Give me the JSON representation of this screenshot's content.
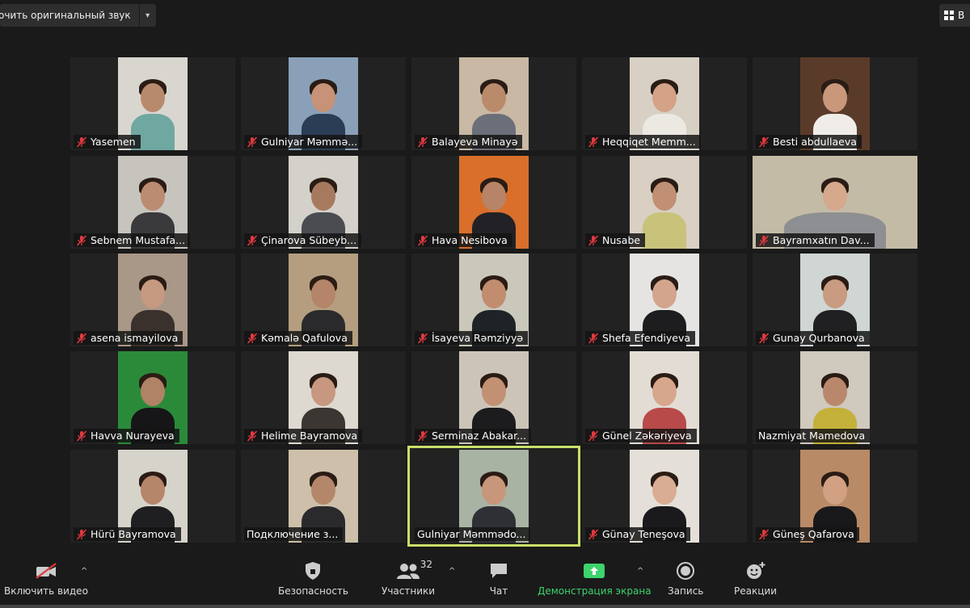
{
  "topbar": {
    "original_sound_label": "очить оригинальный звук",
    "dropdown_caret": "▾",
    "view_label": "В"
  },
  "participants": [
    {
      "name": "Yasemen",
      "muted": true,
      "bg": "#d9d6d0",
      "skin": "#b78a6c",
      "shirt": "#6fa7a1"
    },
    {
      "name": "Gulniyar Məmmə...",
      "muted": true,
      "bg": "#8aa0b8",
      "skin": "#c69378",
      "shirt": "#2b3d55"
    },
    {
      "name": "Balayeva Minayə",
      "muted": true,
      "bg": "#c8b8a4",
      "skin": "#b98b6b",
      "shirt": "#6b6f7a"
    },
    {
      "name": "Heqqiqet Memm...",
      "muted": true,
      "bg": "#d8d0c4",
      "skin": "#d4a287",
      "shirt": "#ece8e2"
    },
    {
      "name": "Besti abdullaeva",
      "muted": true,
      "bg": "#5a3b2a",
      "skin": "#c9987b",
      "shirt": "#f0ede8"
    },
    {
      "name": "Sebnem Mustafa...",
      "muted": true,
      "bg": "#c7c4be",
      "skin": "#bb8c72",
      "shirt": "#3a3a3c"
    },
    {
      "name": "Çinarova Sübeyb...",
      "muted": true,
      "bg": "#d3d1c9",
      "skin": "#a77a60",
      "shirt": "#4a4c52"
    },
    {
      "name": "Hava Nesibova",
      "muted": true,
      "bg": "#d96f2b",
      "skin": "#b78467",
      "shirt": "#222226"
    },
    {
      "name": "Nusabe",
      "muted": true,
      "bg": "#d9cfc3",
      "skin": "#c18f73",
      "shirt": "#c9c27a"
    },
    {
      "name": "Bayramxatın Dav...",
      "muted": true,
      "bg": "#c4bba6",
      "skin": "#d6a88c",
      "shirt": "#8d8f92"
    },
    {
      "name": "asena ismayilova",
      "muted": true,
      "bg": "#a99787",
      "skin": "#c69a80",
      "shirt": "#3a302c"
    },
    {
      "name": "Kəmalə Qafulova",
      "muted": true,
      "bg": "#b49e7f",
      "skin": "#b48568",
      "shirt": "#2a2a2c"
    },
    {
      "name": "İsayeva Rəmziyyə",
      "muted": true,
      "bg": "#c9c8bb",
      "skin": "#c28c6f",
      "shirt": "#1e2327"
    },
    {
      "name": "Shefa Efendiyeva",
      "muted": true,
      "bg": "#e6e4e2",
      "skin": "#d2a58c",
      "shirt": "#1d1d1f"
    },
    {
      "name": "Gunay Qurbanova",
      "muted": true,
      "bg": "#cfd6d4",
      "skin": "#c99b80",
      "shirt": "#202022"
    },
    {
      "name": "Havva Nurayeva",
      "muted": true,
      "bg": "#2a8a3a",
      "skin": "#b08266",
      "shirt": "#161618"
    },
    {
      "name": "Helime Bayramova",
      "muted": true,
      "bg": "#ddd8d0",
      "skin": "#c79780",
      "shirt": "#3c3632"
    },
    {
      "name": "Serminaz Abakar...",
      "muted": true,
      "bg": "#cdc4b8",
      "skin": "#c29173",
      "shirt": "#1c1c1e"
    },
    {
      "name": "Günel Zəkəriyeva",
      "muted": true,
      "bg": "#e3dcd4",
      "skin": "#d6a78c",
      "shirt": "#b84a4a"
    },
    {
      "name": "Nazmiyat Mamedova",
      "muted": false,
      "bg": "#cfc9be",
      "skin": "#b9886c",
      "shirt": "#c4b13a"
    },
    {
      "name": "Hürü Bayramova",
      "muted": true,
      "bg": "#d6d3cb",
      "skin": "#b5866a",
      "shirt": "#1f1f21"
    },
    {
      "name": "Подключение з...",
      "muted": false,
      "bg": "#cdbfa9",
      "skin": "#b4876b",
      "shirt": "#2a2a2c"
    },
    {
      "name": "Gulniyar Məmmədo...",
      "muted": false,
      "bg": "#a9b3a4",
      "skin": "#c8967b",
      "shirt": "#2f3035",
      "active": true
    },
    {
      "name": "Günay Teneşova",
      "muted": true,
      "bg": "#e4dfd8",
      "skin": "#d9ad93",
      "shirt": "#1a1a1c"
    },
    {
      "name": "Güneş Qafarova",
      "muted": true,
      "bg": "#b98a66",
      "skin": "#d2a184",
      "shirt": "#18181a"
    }
  ],
  "toolbar": {
    "video": {
      "label": "Включить видео"
    },
    "security": {
      "label": "Безопасность"
    },
    "participants": {
      "label": "Участники",
      "count": "32"
    },
    "chat": {
      "label": "Чат"
    },
    "share": {
      "label": "Демонстрация экрана"
    },
    "record": {
      "label": "Запись"
    },
    "reactions": {
      "label": "Реакции"
    },
    "caret": "^"
  },
  "colors": {
    "active_outline": "#c9e06a",
    "muted_mic": "#e0393e",
    "share_green": "#3dd36d"
  }
}
